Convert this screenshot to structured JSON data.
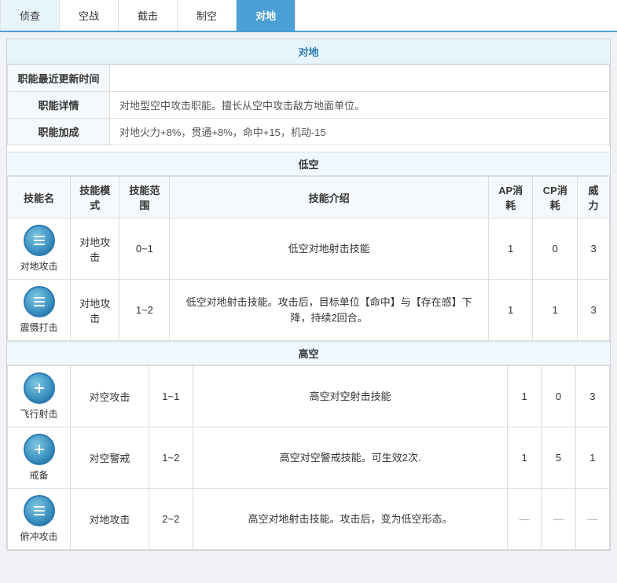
{
  "nav": {
    "tabs": [
      {
        "label": "侦查",
        "active": false
      },
      {
        "label": "空战",
        "active": false
      },
      {
        "label": "截击",
        "active": false
      },
      {
        "label": "制空",
        "active": false
      },
      {
        "label": "对地",
        "active": true
      }
    ]
  },
  "main_section_title": "对地",
  "info_rows": [
    {
      "label": "职能最近更新时间",
      "value": ""
    },
    {
      "label": "职能详情",
      "value": "对地型空中攻击职能。擅长从空中攻击敌方地面单位。"
    },
    {
      "label": "职能加成",
      "value": "对地火力+8%，贯通+8%，命中+15，机动-15"
    }
  ],
  "low_sky": {
    "title": "低空",
    "skills": [
      {
        "name": "对地攻击",
        "icon_type": "lines",
        "mode": "对地攻击",
        "range": "0~1",
        "desc": "低空对地射击技能",
        "ap": "1",
        "cp": "0",
        "power": "3"
      },
      {
        "name": "震慑打击",
        "icon_type": "lines",
        "mode": "对地攻击",
        "range": "1~2",
        "desc": "低空对地射击技能。攻击后，目标单位【命中】与【存在感】下降，持续2回合。",
        "ap": "1",
        "cp": "1",
        "power": "3"
      }
    ]
  },
  "high_sky": {
    "title": "高空",
    "skills": [
      {
        "name": "飞行射击",
        "icon_type": "cross",
        "mode": "对空攻击",
        "range": "1~1",
        "desc": "高空对空射击技能",
        "ap": "1",
        "cp": "0",
        "power": "3"
      },
      {
        "name": "戒备",
        "icon_type": "cross",
        "mode": "对空警戒",
        "range": "1~2",
        "desc": "高空对空警戒技能。可生效2次.",
        "ap": "1",
        "cp": "5",
        "power": "1"
      },
      {
        "name": "俯冲攻击",
        "icon_type": "lines",
        "mode": "对地攻击",
        "range": "2~2",
        "desc": "高空对地射击技能。攻击后，变为低空形态。",
        "ap": "",
        "cp": "",
        "power": ""
      }
    ]
  },
  "table_headers": {
    "skill_name": "技能名",
    "mode": "技能模式",
    "range": "技能范围",
    "desc": "技能介绍",
    "ap": "AP消耗",
    "cp": "CP消耗",
    "power": "威力"
  }
}
